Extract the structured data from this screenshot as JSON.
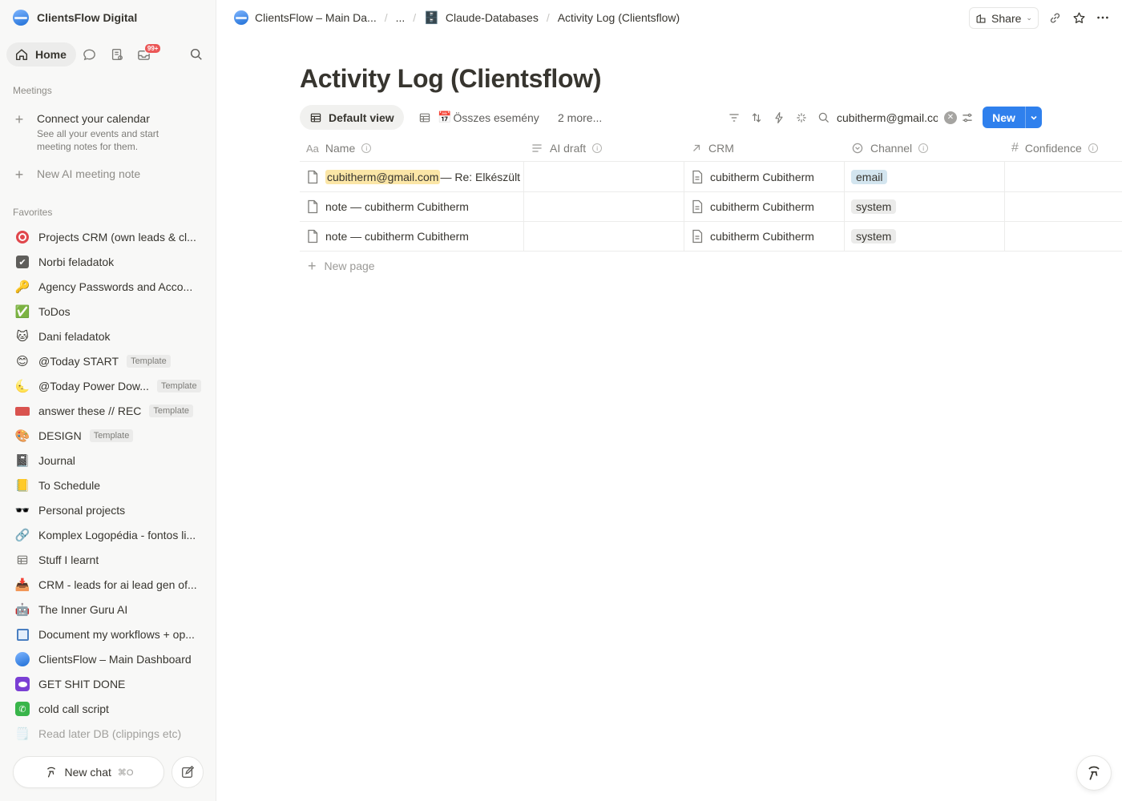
{
  "sidebar": {
    "workspace": "ClientsFlow Digital",
    "home_label": "Home",
    "inbox_badge": "99+",
    "meetings_label": "Meetings",
    "connect_calendar": "Connect your calendar",
    "connect_desc": "See all your events and start meeting notes for them.",
    "new_ai_note": "New AI meeting note",
    "favorites_label": "Favorites",
    "favorites": [
      {
        "label": "Projects CRM (own leads & cl...",
        "icon": "target-icon"
      },
      {
        "label": "Norbi feladatok",
        "icon": "checkbox-icon"
      },
      {
        "label": "Agency Passwords and Acco...",
        "icon": "key-icon"
      },
      {
        "label": "ToDos",
        "icon": "check-mark-icon"
      },
      {
        "label": "Dani feladatok",
        "icon": "cat-icon"
      },
      {
        "label": "@Today START",
        "icon": "smile-icon",
        "tag": "Template"
      },
      {
        "label": "@Today Power Dow...",
        "icon": "moon-icon",
        "tag": "Template"
      },
      {
        "label": "answer these // REC",
        "icon": "video-camera-icon",
        "tag": "Template"
      },
      {
        "label": "DESIGN",
        "icon": "palette-icon",
        "tag": "Template"
      },
      {
        "label": "Journal",
        "icon": "notebook-icon"
      },
      {
        "label": "To Schedule",
        "icon": "ledger-icon"
      },
      {
        "label": "Personal projects",
        "icon": "sunglasses-icon"
      },
      {
        "label": "Komplex Logopédia - fontos li...",
        "icon": "link-icon"
      },
      {
        "label": "Stuff I learnt",
        "icon": "table-icon"
      },
      {
        "label": "CRM - leads for ai lead gen of...",
        "icon": "inbox-tray-icon"
      },
      {
        "label": "The Inner Guru AI",
        "icon": "robot-icon"
      },
      {
        "label": "Document my workflows + op...",
        "icon": "chip-icon"
      },
      {
        "label": "ClientsFlow – Main Dashboard",
        "icon": "clientsflow-logo-icon"
      },
      {
        "label": "GET SHIT DONE",
        "icon": "purple-eye-icon"
      },
      {
        "label": "cold call script",
        "icon": "phone-icon"
      },
      {
        "label": "Read later DB (clippings etc)",
        "icon": "memo-icon"
      }
    ],
    "new_chat": "New chat",
    "new_chat_kbd": "⌘O"
  },
  "topbar": {
    "breadcrumbs": [
      "ClientsFlow – Main Da...",
      "...",
      "Claude-Databases",
      "Activity Log (Clientsflow)"
    ],
    "share": "Share"
  },
  "page": {
    "title": "Activity Log (Clientsflow)",
    "views": [
      "Default view",
      "Összes esemény",
      "2 more..."
    ],
    "search_value": "cubitherm@gmail.com",
    "new_button": "New"
  },
  "table": {
    "columns": [
      "Name",
      "AI draft",
      "CRM",
      "Channel",
      "Confidence"
    ],
    "rows": [
      {
        "name_highlight": "cubitherm@gmail.com",
        "name_rest": " — Re: Elkészült",
        "ai_draft": "",
        "crm": "cubitherm Cubitherm",
        "channel": "email",
        "confidence": ""
      },
      {
        "name_highlight": "",
        "name_rest": "note — cubitherm Cubitherm",
        "ai_draft": "",
        "crm": "cubitherm Cubitherm",
        "channel": "system",
        "confidence": ""
      },
      {
        "name_highlight": "",
        "name_rest": "note — cubitherm Cubitherm",
        "ai_draft": "",
        "crm": "cubitherm Cubitherm",
        "channel": "system",
        "confidence": ""
      }
    ],
    "new_page": "New page"
  },
  "colors": {
    "accent": "#2f80ed",
    "highlight": "#fbe6a7",
    "email_tag": "#d3e5ef",
    "system_tag": "#ebebea",
    "badge": "#eb5757"
  }
}
